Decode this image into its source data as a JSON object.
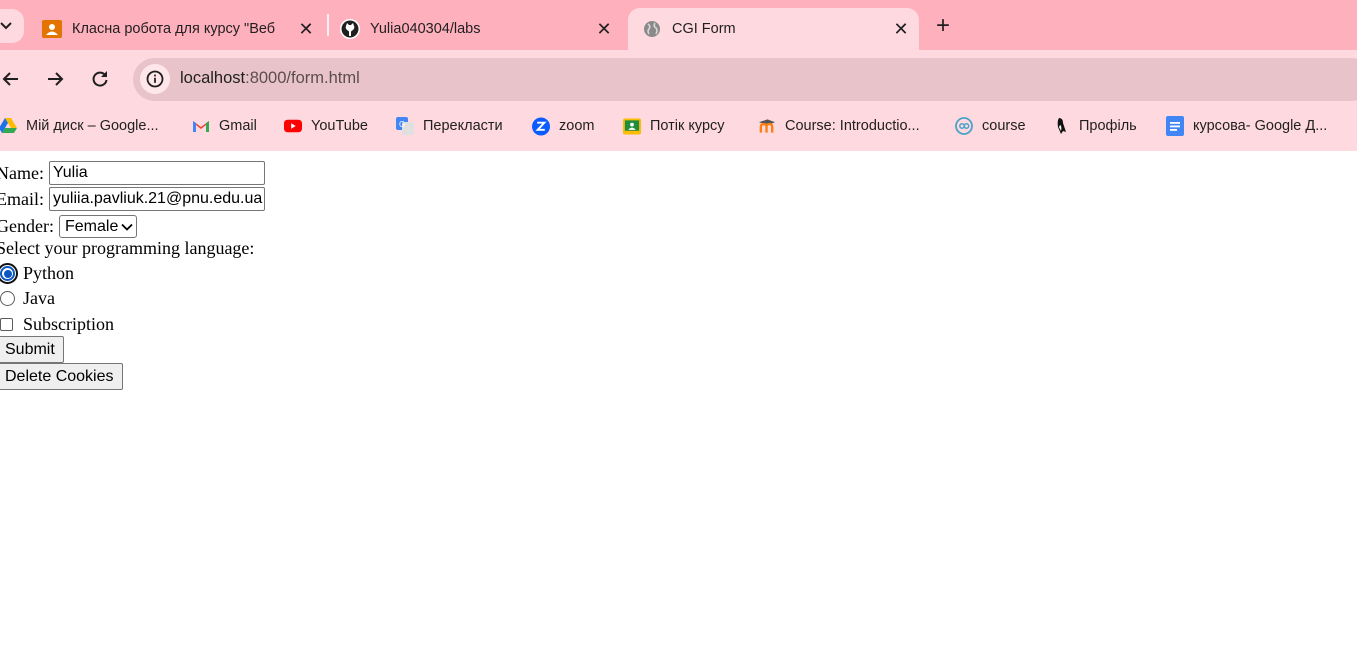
{
  "browser": {
    "tabs": [
      {
        "title": "Класна робота для курсу \"Веб",
        "icon": "google-classroom-icon",
        "active": false
      },
      {
        "title": "Yulia040304/labs",
        "icon": "github-icon",
        "active": false
      },
      {
        "title": "CGI Form",
        "icon": "globe-icon",
        "active": true
      }
    ],
    "url_host": "localhost",
    "url_path": ":8000/form.html",
    "bookmarks": [
      {
        "label": "Мій диск – Google...",
        "icon": "google-drive-icon"
      },
      {
        "label": "Gmail",
        "icon": "gmail-icon"
      },
      {
        "label": "YouTube",
        "icon": "youtube-icon"
      },
      {
        "label": "Перекласти",
        "icon": "google-translate-icon"
      },
      {
        "label": "zoom",
        "icon": "zoom-icon"
      },
      {
        "label": "Потік курсу",
        "icon": "google-classroom-icon"
      },
      {
        "label": "Course: Introductio...",
        "icon": "moodle-icon"
      },
      {
        "label": "course",
        "icon": "course-icon"
      },
      {
        "label": "Профіль",
        "icon": "penguin-icon"
      },
      {
        "label": "курсова- Google Д...",
        "icon": "google-docs-icon"
      }
    ],
    "colors": {
      "tabstrip": "#ffb0bd",
      "toolbar": "#ffd9e0",
      "omnibox": "#e8c4ca"
    }
  },
  "form": {
    "name_label": "Name:",
    "name_value": "Yulia",
    "email_label": "Email:",
    "email_value": "yuliia.pavliuk.21@pnu.edu.ua",
    "gender_label": "Gender:",
    "gender_value": "Female",
    "language_prompt": "Select your programming language:",
    "languages": [
      {
        "label": "Python",
        "checked": true
      },
      {
        "label": "Java",
        "checked": false
      }
    ],
    "subscription_label": "Subscription",
    "subscription_checked": false,
    "submit_label": "Submit",
    "delete_cookies_label": "Delete Cookies"
  }
}
